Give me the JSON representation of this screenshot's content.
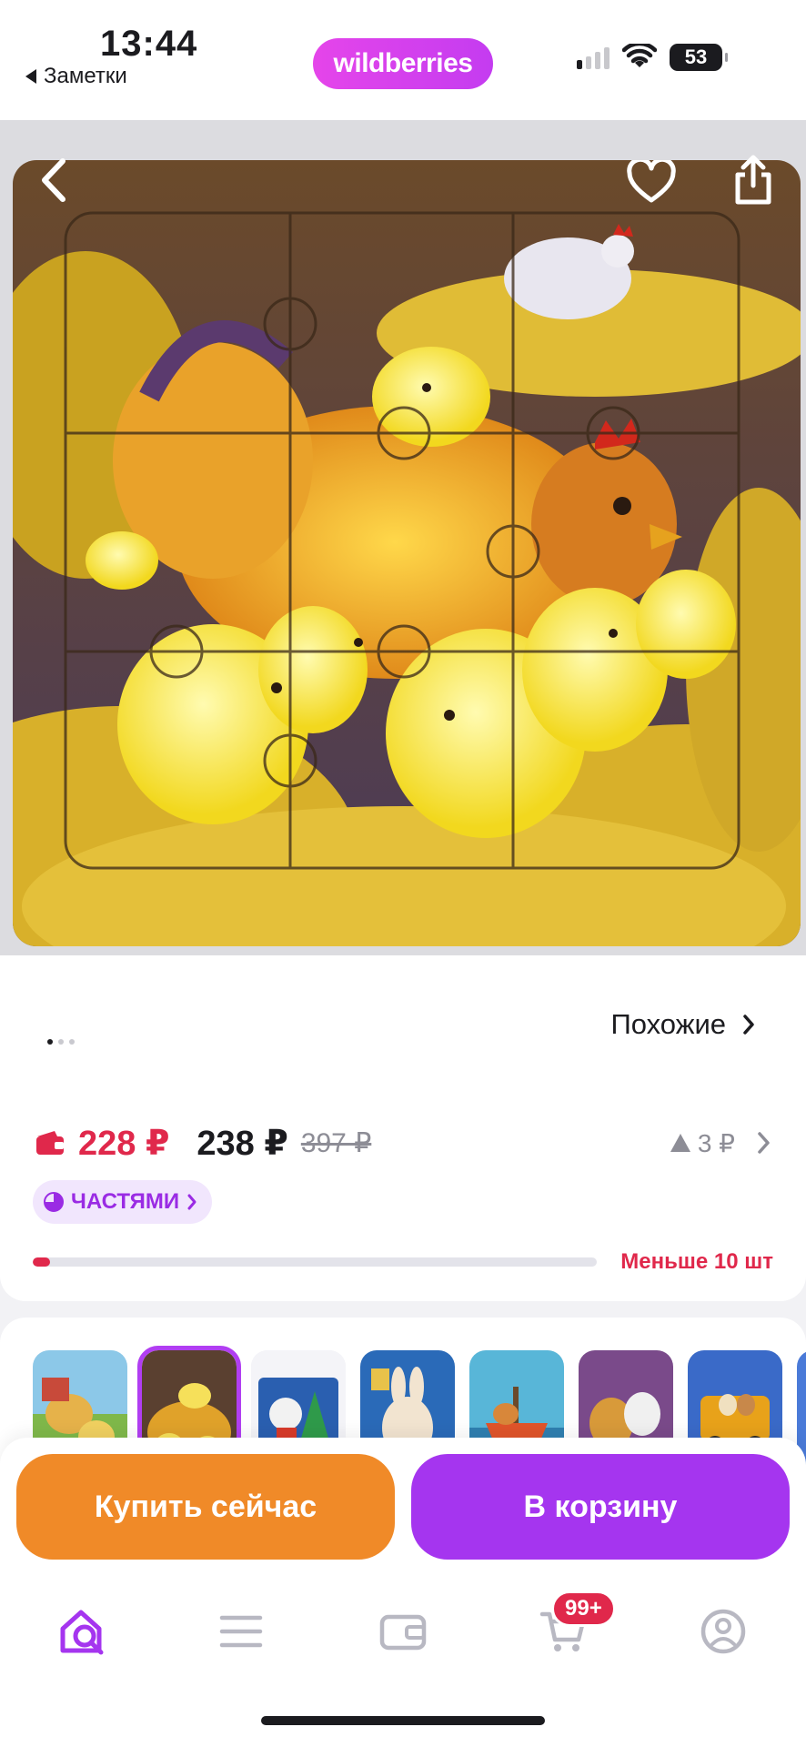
{
  "status_bar": {
    "time": "13:44",
    "back_app": "Заметки",
    "battery": "53"
  },
  "header": {
    "logo": "wildberries"
  },
  "gallery": {
    "similar_label": "Похожие",
    "dots_count": 3,
    "active_dot": 0
  },
  "pricing": {
    "wallet_price": "228 ₽",
    "price": "238 ₽",
    "old_price": "397 ₽",
    "delta": "3 ₽",
    "installments_label": "ЧАСТЯМИ"
  },
  "stock": {
    "label": "Меньше 10 шт",
    "level": 0.03
  },
  "variants": {
    "count": 8,
    "selected_index": 1
  },
  "actions": {
    "buy_now": "Купить сейчас",
    "add_to_cart": "В корзину"
  },
  "tabbar": {
    "cart_badge": "99+"
  },
  "colors": {
    "brand": "#c43cf0",
    "buy": "#f08a28",
    "cart": "#a535ef",
    "price_red": "#e0284b"
  }
}
